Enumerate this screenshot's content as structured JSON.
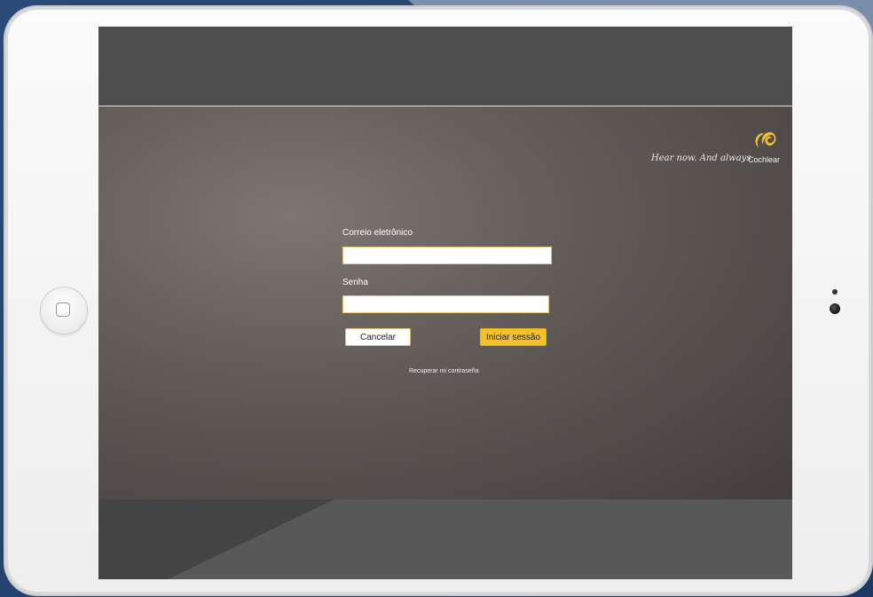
{
  "brand": {
    "tagline": "Hear now. And always",
    "name": "Cochlear",
    "accent_color": "#f2c12b"
  },
  "login_form": {
    "email_label": "Correio eletrônico",
    "email_value": "",
    "password_label": "Senha",
    "password_value": "",
    "cancel_label": "Cancelar",
    "submit_label": "Iniciar sessão",
    "recover_link": "Recuperar mi contraseña"
  },
  "icons": {
    "logo": "cochlear-logo-icon",
    "home": "home-button-icon",
    "camera": "camera-icon"
  }
}
